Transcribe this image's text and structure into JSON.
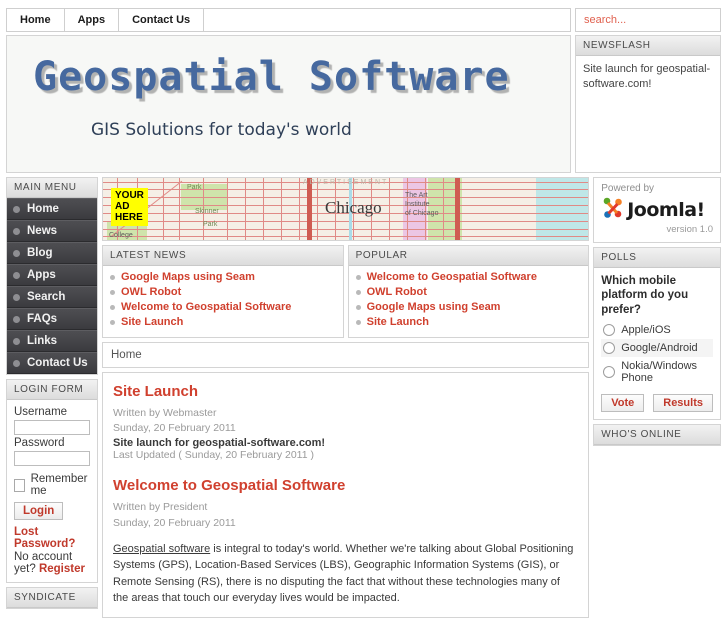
{
  "topnav": {
    "items": [
      {
        "label": "Home"
      },
      {
        "label": "Apps"
      },
      {
        "label": "Contact Us"
      }
    ]
  },
  "search": {
    "placeholder": "search...",
    "value": ""
  },
  "header": {
    "title": "Geospatial Software",
    "tagline": "GIS Solutions for today's world",
    "title_color": "#46699f"
  },
  "newsflash": {
    "title": "NEWSFLASH",
    "text": "Site launch for geospatial-software.com!"
  },
  "mainmenu": {
    "title": "MAIN MENU",
    "items": [
      {
        "label": "Home"
      },
      {
        "label": "News"
      },
      {
        "label": "Blog"
      },
      {
        "label": "Apps"
      },
      {
        "label": "Search"
      },
      {
        "label": "FAQs"
      },
      {
        "label": "Links"
      },
      {
        "label": "Contact Us"
      }
    ]
  },
  "loginform": {
    "title": "LOGIN FORM",
    "username_label": "Username",
    "username_value": "",
    "password_label": "Password",
    "password_value": "",
    "remember_label": "Remember me",
    "login_button": "Login",
    "lost_password": "Lost Password?",
    "no_account_prefix": "No account yet?",
    "register": "Register"
  },
  "syndicate": {
    "title": "SYNDICATE"
  },
  "advertisement": {
    "label": "ADVERTISEMENT",
    "ad_text_line1": "YOUR",
    "ad_text_line2": "AD",
    "ad_text_line3": "HERE",
    "map_city": "Chicago",
    "map_poi": "The Art\nInstitute\nof Chicago",
    "map_park1": "Park",
    "map_park2": "Skinner\nPark",
    "map_college": "College"
  },
  "latest_news": {
    "title": "LATEST NEWS",
    "items": [
      {
        "label": "Google Maps using Seam"
      },
      {
        "label": "OWL Robot"
      },
      {
        "label": "Welcome to Geospatial Software"
      },
      {
        "label": "Site Launch"
      }
    ]
  },
  "popular": {
    "title": "POPULAR",
    "items": [
      {
        "label": "Welcome to Geospatial Software"
      },
      {
        "label": "OWL Robot"
      },
      {
        "label": "Google Maps using Seam"
      },
      {
        "label": "Site Launch"
      }
    ]
  },
  "breadcrumb": {
    "text": "Home"
  },
  "articles": [
    {
      "title": "Site Launch",
      "written_by": "Written by Webmaster",
      "date": "Sunday, 20 February 2011",
      "lead": "Site launch for geospatial-software.com!",
      "last_updated": "Last Updated ( Sunday, 20 February 2011 )"
    },
    {
      "title": "Welcome to Geospatial Software",
      "written_by": "Written by President",
      "date": "Sunday, 20 February 2011",
      "body_link": "Geospatial software",
      "body_rest": " is integral to today's world. Whether we're talking about Global Positioning Systems (GPS), Location-Based Services (LBS), Geographic Information Systems (GIS), or Remote Sensing (RS), there is no disputing the fact that without these technologies many of the areas that touch our everyday lives would be impacted."
    }
  ],
  "powered_by": {
    "label": "Powered by",
    "brand": "Joomla!",
    "version": "version 1.0"
  },
  "polls": {
    "title": "POLLS",
    "question": "Which mobile platform do you prefer?",
    "options": [
      {
        "label": "Apple/iOS"
      },
      {
        "label": "Google/Android"
      },
      {
        "label": "Nokia/Windows Phone"
      }
    ],
    "vote_button": "Vote",
    "results_button": "Results"
  },
  "whos_online": {
    "title": "WHO'S ONLINE"
  }
}
